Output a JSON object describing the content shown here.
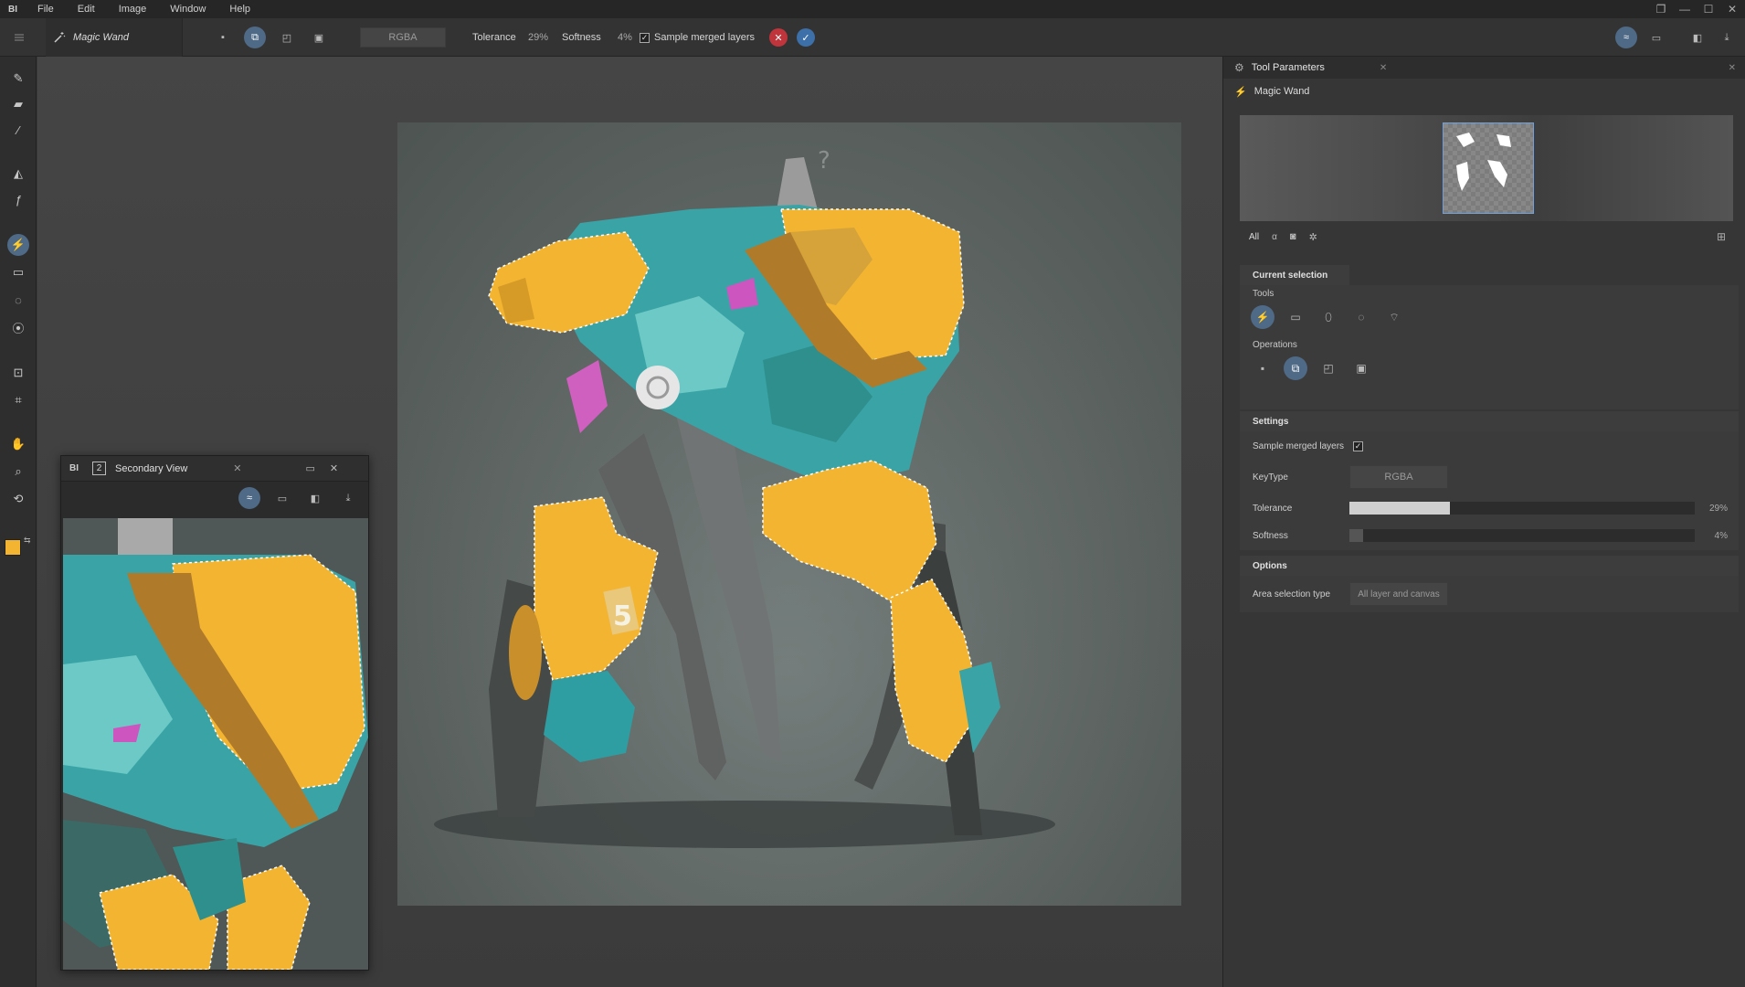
{
  "app": {
    "logo": "BI"
  },
  "menu": [
    "File",
    "Edit",
    "Image",
    "Window",
    "Help"
  ],
  "window_controls": [
    "❐",
    "—",
    "☐",
    "✕"
  ],
  "options_bar": {
    "tool_name": "Magic Wand",
    "keytype_value": "RGBA",
    "tolerance_label": "Tolerance",
    "tolerance_value": "29%",
    "softness_label": "Softness",
    "softness_value": "4%",
    "sample_merged_label": "Sample merged layers",
    "sample_merged_checked": true
  },
  "secondary_view": {
    "number": "2",
    "title": "Secondary View",
    "logo": "BI"
  },
  "panel": {
    "tab_title": "Tool Parameters",
    "tool_name": "Magic Wand",
    "preview_tabs": [
      "All",
      "α"
    ],
    "current_selection": {
      "heading": "Current selection",
      "tools_label": "Tools",
      "operations_label": "Operations"
    },
    "settings": {
      "heading": "Settings",
      "sample_merged_label": "Sample merged layers",
      "sample_merged_checked": true,
      "keytype_label": "KeyType",
      "keytype_value": "RGBA",
      "tolerance_label": "Tolerance",
      "tolerance_value": "29%",
      "tolerance_fraction": 0.29,
      "softness_label": "Softness",
      "softness_value": "4%",
      "softness_fraction": 0.04
    },
    "options": {
      "heading": "Options",
      "area_label": "Area selection type",
      "area_value": "All layer and canvas"
    }
  },
  "colors": {
    "foreground": "#f2b431",
    "background": "#b8343a",
    "accent": "#4f6a86",
    "cancel": "#c0343c",
    "confirm": "#3d6fa8"
  }
}
